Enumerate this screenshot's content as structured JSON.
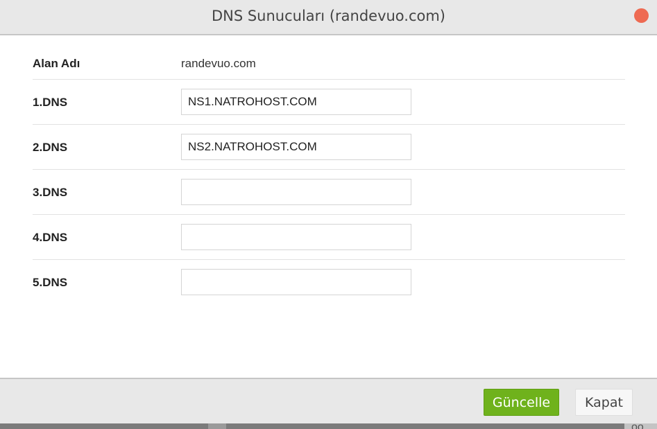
{
  "dialog": {
    "title": "DNS Sunucuları (randevuo.com)"
  },
  "domain_row": {
    "label": "Alan Adı",
    "value": "randevuo.com"
  },
  "dns_rows": [
    {
      "label": "1.DNS",
      "value": "NS1.NATROHOST.COM"
    },
    {
      "label": "2.DNS",
      "value": "NS2.NATROHOST.COM"
    },
    {
      "label": "3.DNS",
      "value": ""
    },
    {
      "label": "4.DNS",
      "value": ""
    },
    {
      "label": "5.DNS",
      "value": ""
    }
  ],
  "footer": {
    "update_label": "Güncelle",
    "close_label": "Kapat"
  },
  "backdrop": {
    "partial_text": "oo qu"
  },
  "colors": {
    "close_dot": "#ee6a52",
    "update_button": "#6fb21c",
    "header_bg": "#e8e8e8"
  }
}
